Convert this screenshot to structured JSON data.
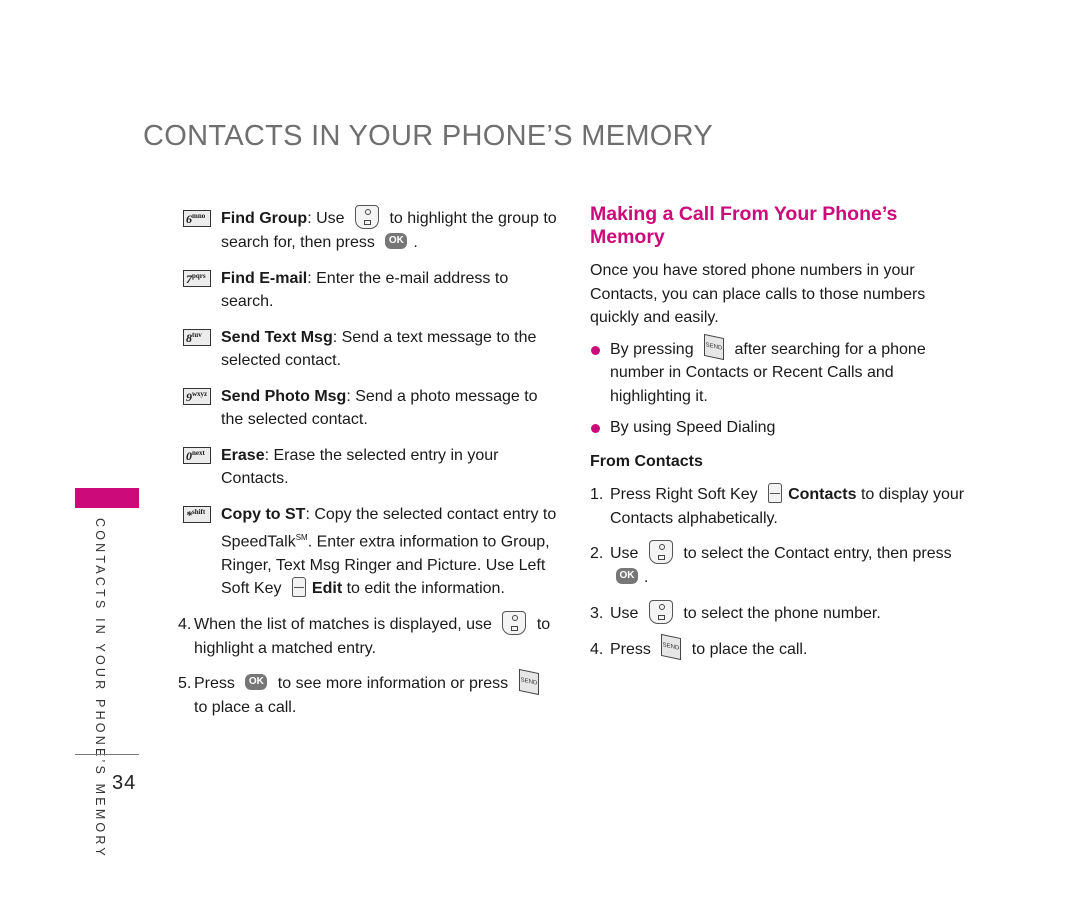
{
  "header": {
    "title": "CONTACTS IN YOUR PHONE’S MEMORY"
  },
  "sidebar": {
    "section_label": "CONTACTS IN YOUR PHONE’S MEMORY",
    "accent_color": "#cc0a7a"
  },
  "footer": {
    "page_number": "34"
  },
  "left_column": {
    "options": [
      {
        "key_digit": "6",
        "key_letters": "mno",
        "key_icon": "key-6-icon",
        "title": "Find Group",
        "text_before": ": Use ",
        "icon": "navigation-key-icon",
        "text_mid": " to highlight the group to search for, then press ",
        "icon2": "ok-key-icon",
        "text_after": "."
      },
      {
        "key_digit": "7",
        "key_letters": "pqrs",
        "key_icon": "key-7-icon",
        "title": "Find E-mail",
        "text": ": Enter the e-mail address to search."
      },
      {
        "key_digit": "8",
        "key_letters": "tuv",
        "key_icon": "key-8-icon",
        "title": "Send Text Msg",
        "text": ": Send a text message to the selected contact."
      },
      {
        "key_digit": "9",
        "key_letters": "wxyz",
        "key_icon": "key-9-icon",
        "title": "Send Photo Msg",
        "text": ": Send a photo message to the selected contact."
      },
      {
        "key_digit": "0",
        "key_letters": "next",
        "key_icon": "key-0-icon",
        "title": "Erase",
        "text": ": Erase the selected entry in your Contacts."
      },
      {
        "key_digit": "*",
        "key_letters": "shift",
        "key_icon": "key-star-icon",
        "title": "Copy to ST",
        "text_before": ": Copy the selected contact entry to SpeedTalk",
        "superscript": "SM",
        "text_mid": ". Enter extra information to Group, Ringer, Text Msg Ringer and Picture. Use Left Soft Key ",
        "icon": "left-soft-key-icon",
        "bold2": "Edit",
        "text_after": " to edit the information."
      }
    ],
    "steps": [
      {
        "num": "4.",
        "text_before": "When the list of matches is displayed, use ",
        "icon": "navigation-key-icon",
        "text_after": " to highlight a matched entry."
      },
      {
        "num": "5.",
        "text_before": "Press ",
        "icon": "ok-key-icon",
        "text_mid": " to see more information or press ",
        "icon2": "send-key-icon",
        "text_after": " to place a call."
      }
    ]
  },
  "right_column": {
    "heading": "Making a Call From Your Phone’s Memory",
    "intro": "Once you have stored phone numbers in your Contacts, you can place calls to those numbers quickly and easily.",
    "bullets": [
      {
        "text_before": "By pressing ",
        "icon": "send-key-icon",
        "text_after": " after searching for a phone number in Contacts or Recent Calls and highlighting it."
      },
      {
        "text": "By using Speed Dialing"
      }
    ],
    "subheading": "From Contacts",
    "steps": [
      {
        "num": "1.",
        "text_before": "Press Right Soft Key ",
        "icon": "right-soft-key-icon",
        "bold": "Contacts",
        "text_after": " to display your Contacts alphabetically."
      },
      {
        "num": "2.",
        "text_before": "Use ",
        "icon": "navigation-key-icon",
        "text_mid": " to select the Contact entry, then press ",
        "icon2": "ok-key-icon",
        "text_after": "."
      },
      {
        "num": "3.",
        "text_before": "Use ",
        "icon": "navigation-key-icon",
        "text_after": " to select the phone number."
      },
      {
        "num": "4.",
        "text_before": "Press ",
        "icon": "send-key-icon",
        "text_after": " to place the call."
      }
    ]
  },
  "icon_labels": {
    "ok": "OK",
    "send": "SEND"
  }
}
